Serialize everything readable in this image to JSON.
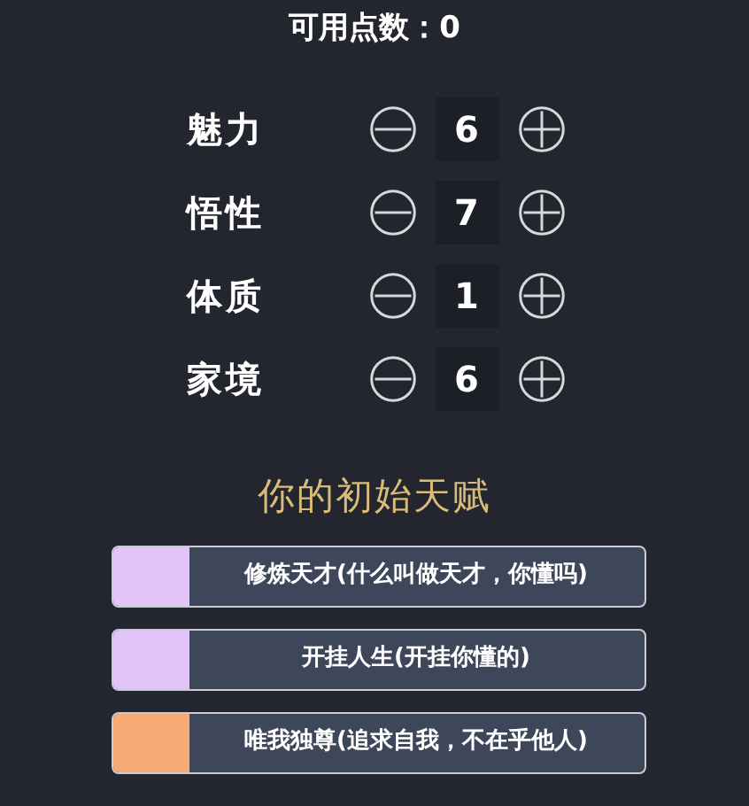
{
  "points": {
    "label": "可用点数：0"
  },
  "stats": [
    {
      "name": "魅力",
      "value": "6"
    },
    {
      "name": "悟性",
      "value": "7"
    },
    {
      "name": "体质",
      "value": "1"
    },
    {
      "name": "家境",
      "value": "6"
    }
  ],
  "talents_heading": "你的初始天赋",
  "talents": [
    {
      "text": "修炼天才(什么叫做天才，你懂吗)",
      "color": "#e2c4f8"
    },
    {
      "text": "开挂人生(开挂你懂的)",
      "color": "#e2c4f8"
    },
    {
      "text": "唯我独尊(追求自我，不在乎他人)",
      "color": "#f7ab74"
    }
  ]
}
